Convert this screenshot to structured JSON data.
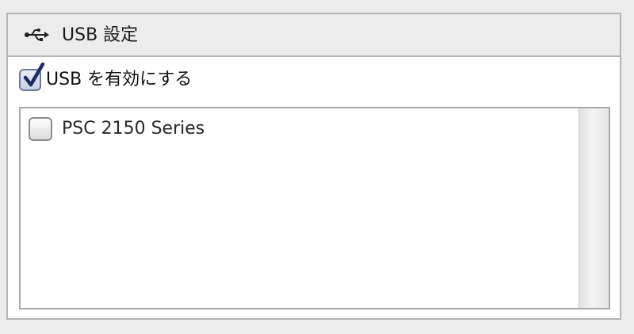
{
  "header": {
    "icon": "usb-icon",
    "title": "USB 設定"
  },
  "enable_usb": {
    "label": "USB を有効にする",
    "checked": true
  },
  "device_list": {
    "items": [
      {
        "label": "PSC 2150 Series",
        "checked": false
      }
    ]
  }
}
